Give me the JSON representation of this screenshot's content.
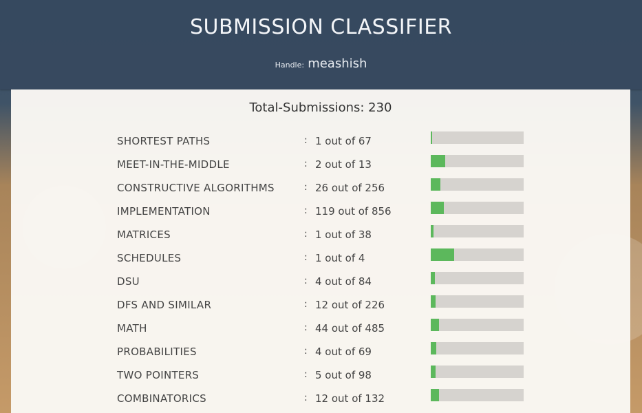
{
  "header": {
    "title": "SUBMISSION CLASSIFIER",
    "handle_label": "Handle:",
    "handle_value": "meashish"
  },
  "total_label": "Total-Submissions: 230",
  "rows": [
    {
      "tag": "SHORTEST PATHS",
      "count_text": "1 out of 67",
      "fraction": 0.015
    },
    {
      "tag": "MEET-IN-THE-MIDDLE",
      "count_text": "2 out of 13",
      "fraction": 0.154
    },
    {
      "tag": "CONSTRUCTIVE ALGORITHMS",
      "count_text": "26 out of 256",
      "fraction": 0.102
    },
    {
      "tag": "IMPLEMENTATION",
      "count_text": "119 out of 856",
      "fraction": 0.139
    },
    {
      "tag": "MATRICES",
      "count_text": "1 out of 38",
      "fraction": 0.026
    },
    {
      "tag": "SCHEDULES",
      "count_text": "1 out of 4",
      "fraction": 0.25
    },
    {
      "tag": "DSU",
      "count_text": "4 out of 84",
      "fraction": 0.048
    },
    {
      "tag": "DFS AND SIMILAR",
      "count_text": "12 out of 226",
      "fraction": 0.053
    },
    {
      "tag": "MATH",
      "count_text": "44 out of 485",
      "fraction": 0.091
    },
    {
      "tag": "PROBABILITIES",
      "count_text": "4 out of 69",
      "fraction": 0.058
    },
    {
      "tag": "TWO POINTERS",
      "count_text": "5 out of 98",
      "fraction": 0.051
    },
    {
      "tag": "COMBINATORICS",
      "count_text": "12 out of 132",
      "fraction": 0.091
    }
  ],
  "colors": {
    "bar_fill": "#5cb85c",
    "bar_track": "#d6d3cf",
    "header_bg": "#36495e"
  }
}
